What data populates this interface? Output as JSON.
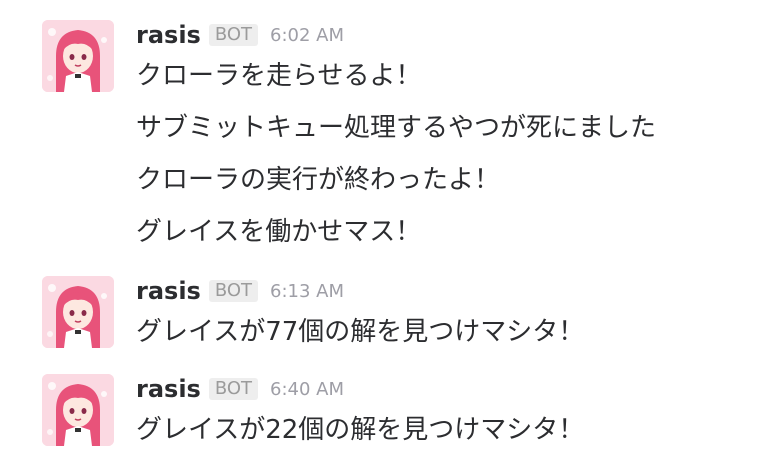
{
  "messages": [
    {
      "username": "rasis",
      "badge": "BOT",
      "time": "6:02 AM",
      "lines": [
        "クローラを走らせるよ！",
        "サブミットキュー処理するやつが死にました",
        "クローラの実行が終わったよ！",
        "グレイスを働かせマス！"
      ]
    },
    {
      "username": "rasis",
      "badge": "BOT",
      "time": "6:13 AM",
      "lines": [
        "グレイスが77個の解を見つけマシタ！"
      ]
    },
    {
      "username": "rasis",
      "badge": "BOT",
      "time": "6:40 AM",
      "lines": [
        "グレイスが22個の解を見つけマシタ！"
      ]
    }
  ],
  "colors": {
    "username": "#2c2d30",
    "badge_bg": "#eeeeee",
    "badge_text": "#9b9b9b",
    "timestamp": "#9e9ea6",
    "avatar_bg": "#fbd9e2",
    "avatar_hair": "#e8537a"
  },
  "avatar_icon": "anime-girl-avatar"
}
